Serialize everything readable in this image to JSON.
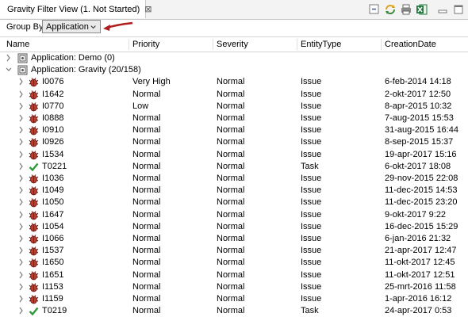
{
  "tab": {
    "title": "Gravity Filter View (1. Not Started)",
    "close_glyph": "⊠"
  },
  "toolbar": {
    "icons": [
      "collapse-all-icon",
      "sync-icon",
      "print-icon",
      "excel-export-icon",
      "minimize-icon",
      "maximize-icon"
    ]
  },
  "groupby": {
    "label": "Group By",
    "value": "Application"
  },
  "columns": [
    "Name",
    "Priority",
    "Severity",
    "EntityType",
    "CreationDate"
  ],
  "groups": [
    {
      "label": "Application: Demo (0)",
      "expanded": false
    },
    {
      "label": "Application: Gravity (20/158)",
      "expanded": true
    }
  ],
  "rows": [
    {
      "name": "I0076",
      "priority": "Very High",
      "severity": "Normal",
      "type": "Issue",
      "date": "6-feb-2014 14:18",
      "icon": "bug-icon"
    },
    {
      "name": "I1642",
      "priority": "Normal",
      "severity": "Normal",
      "type": "Issue",
      "date": "2-okt-2017 12:50",
      "icon": "bug-icon"
    },
    {
      "name": "I0770",
      "priority": "Low",
      "severity": "Normal",
      "type": "Issue",
      "date": "8-apr-2015 10:32",
      "icon": "bug-icon"
    },
    {
      "name": "I0888",
      "priority": "Normal",
      "severity": "Normal",
      "type": "Issue",
      "date": "7-aug-2015 15:53",
      "icon": "bug-icon"
    },
    {
      "name": "I0910",
      "priority": "Normal",
      "severity": "Normal",
      "type": "Issue",
      "date": "31-aug-2015 16:44",
      "icon": "bug-icon"
    },
    {
      "name": "I0926",
      "priority": "Normal",
      "severity": "Normal",
      "type": "Issue",
      "date": "8-sep-2015 15:37",
      "icon": "bug-icon"
    },
    {
      "name": "I1534",
      "priority": "Normal",
      "severity": "Normal",
      "type": "Issue",
      "date": "19-apr-2017 15:16",
      "icon": "bug-icon"
    },
    {
      "name": "T0221",
      "priority": "Normal",
      "severity": "Normal",
      "type": "Task",
      "date": "6-okt-2017 18:08",
      "icon": "check-icon"
    },
    {
      "name": "I1036",
      "priority": "Normal",
      "severity": "Normal",
      "type": "Issue",
      "date": "29-nov-2015 22:08",
      "icon": "bug-icon"
    },
    {
      "name": "I1049",
      "priority": "Normal",
      "severity": "Normal",
      "type": "Issue",
      "date": "11-dec-2015 14:53",
      "icon": "bug-icon"
    },
    {
      "name": "I1050",
      "priority": "Normal",
      "severity": "Normal",
      "type": "Issue",
      "date": "11-dec-2015 23:20",
      "icon": "bug-icon"
    },
    {
      "name": "I1647",
      "priority": "Normal",
      "severity": "Normal",
      "type": "Issue",
      "date": "9-okt-2017 9:22",
      "icon": "bug-icon"
    },
    {
      "name": "I1054",
      "priority": "Normal",
      "severity": "Normal",
      "type": "Issue",
      "date": "16-dec-2015 15:29",
      "icon": "bug-icon"
    },
    {
      "name": "I1066",
      "priority": "Normal",
      "severity": "Normal",
      "type": "Issue",
      "date": "6-jan-2016 21:32",
      "icon": "bug-icon"
    },
    {
      "name": "I1537",
      "priority": "Normal",
      "severity": "Normal",
      "type": "Issue",
      "date": "21-apr-2017 12:47",
      "icon": "bug-icon"
    },
    {
      "name": "I1650",
      "priority": "Normal",
      "severity": "Normal",
      "type": "Issue",
      "date": "11-okt-2017 12:45",
      "icon": "bug-icon"
    },
    {
      "name": "I1651",
      "priority": "Normal",
      "severity": "Normal",
      "type": "Issue",
      "date": "11-okt-2017 12:51",
      "icon": "bug-icon"
    },
    {
      "name": "I1153",
      "priority": "Normal",
      "severity": "Normal",
      "type": "Issue",
      "date": "25-mrt-2016 11:58",
      "icon": "bug-icon"
    },
    {
      "name": "I1159",
      "priority": "Normal",
      "severity": "Normal",
      "type": "Issue",
      "date": "1-apr-2016 16:12",
      "icon": "bug-icon"
    },
    {
      "name": "T0219",
      "priority": "Normal",
      "severity": "Normal",
      "type": "Task",
      "date": "24-apr-2017 0:53",
      "icon": "check-icon"
    }
  ],
  "colors": {
    "bug": "#c0392b",
    "check": "#2e9a3a",
    "annotation_arrow": "#b11d1d"
  }
}
